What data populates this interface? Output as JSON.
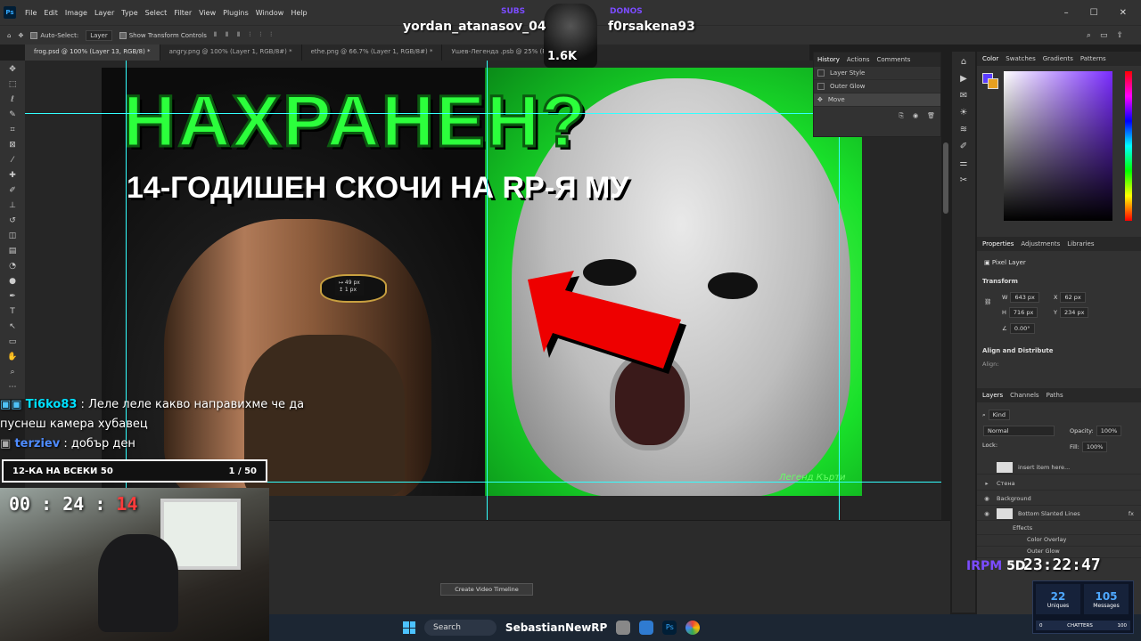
{
  "menubar": {
    "logo": "Ps",
    "items": [
      "File",
      "Edit",
      "Image",
      "Layer",
      "Type",
      "Select",
      "Filter",
      "View",
      "Plugins",
      "Window",
      "Help"
    ]
  },
  "options": {
    "auto_select_label": "Auto-Select:",
    "auto_select_value": "Layer",
    "show_transform_label": "Show Transform Controls"
  },
  "doc_tabs": [
    "frog.psd @ 100% (Layer 13, RGB/8) *",
    "angry.png @ 100% (Layer 1, RGB/8#) *",
    "ethe.png @ 66.7% (Layer 1, RGB/8#) *",
    "Ушев-Легенда .psb @ 25% (RG..."
  ],
  "thumbnail": {
    "headline": "НАХРАНЕН?",
    "subline": "14-ГОДИШЕН СКОЧИ НА RP-Я МУ",
    "watermark": "Легенд Кърти",
    "measure_w": "↦ 49 px",
    "measure_h": "↥ 1 px"
  },
  "history": {
    "tabs": [
      "History",
      "Actions",
      "Comments"
    ],
    "items": [
      "Layer Style",
      "Outer Glow",
      "Move"
    ],
    "selected": "Move"
  },
  "color_panel": {
    "tabs": [
      "Color",
      "Swatches",
      "Gradients",
      "Patterns"
    ],
    "foreground": "#5b3cff",
    "background": "#e6a020"
  },
  "properties": {
    "tabs": [
      "Properties",
      "Adjustments",
      "Libraries"
    ],
    "kind": "Pixel Layer",
    "transform_label": "Transform",
    "w_label": "W",
    "w": "643 px",
    "x_label": "X",
    "x": "62 px",
    "h_label": "H",
    "h": "716 px",
    "y_label": "Y",
    "y": "234 px",
    "angle": "0.00°",
    "align_label": "Align and Distribute",
    "align_sub": "Align:"
  },
  "layers": {
    "tabs": [
      "Layers",
      "Channels",
      "Paths"
    ],
    "kind": "Kind",
    "blend": "Normal",
    "opacity_label": "Opacity:",
    "opacity": "100%",
    "lock_label": "Lock:",
    "fill_label": "Fill:",
    "fill": "100%",
    "rows": [
      {
        "name": "insert item here..."
      },
      {
        "name": "Стена"
      },
      {
        "name": "Background"
      },
      {
        "name": "Bottom Slanted Lines"
      },
      {
        "name": "Effects"
      },
      {
        "name": "Color Overlay"
      },
      {
        "name": "Outer Glow"
      }
    ]
  },
  "timeline": {
    "button": "Create Video Timeline"
  },
  "taskbar": {
    "search": "Search",
    "streamer": "SebastianNewRP"
  },
  "stream": {
    "left_user": "yordan_atanasov_04",
    "left_tag": "SUBS",
    "right_user": "f0rsakena93",
    "right_tag": "DONOS",
    "sub_count": "1.6K",
    "chat": [
      {
        "user": "Ti6ko83",
        "sep": ":",
        "text": "Леле леле какво направихме че да пуснеш камера хубавец"
      },
      {
        "user": "terziev",
        "sep": ":",
        "text": "добър ден"
      }
    ],
    "goal_label": "12-КА НА ВСЕКИ 50",
    "goal_count": "1 / 50",
    "goal_progress": 0.02,
    "timer_a": "00 : 24 :",
    "timer_b": "14",
    "clock_prefix": "IRPM",
    "clock_mid": "5D",
    "clock": "23:22:47",
    "uniques": "22",
    "uniques_label": "Uniques",
    "messages": "105",
    "messages_label": "Messages",
    "chatters_left": "0",
    "chatters_label": "CHATTERS",
    "chatters_right": "100"
  }
}
